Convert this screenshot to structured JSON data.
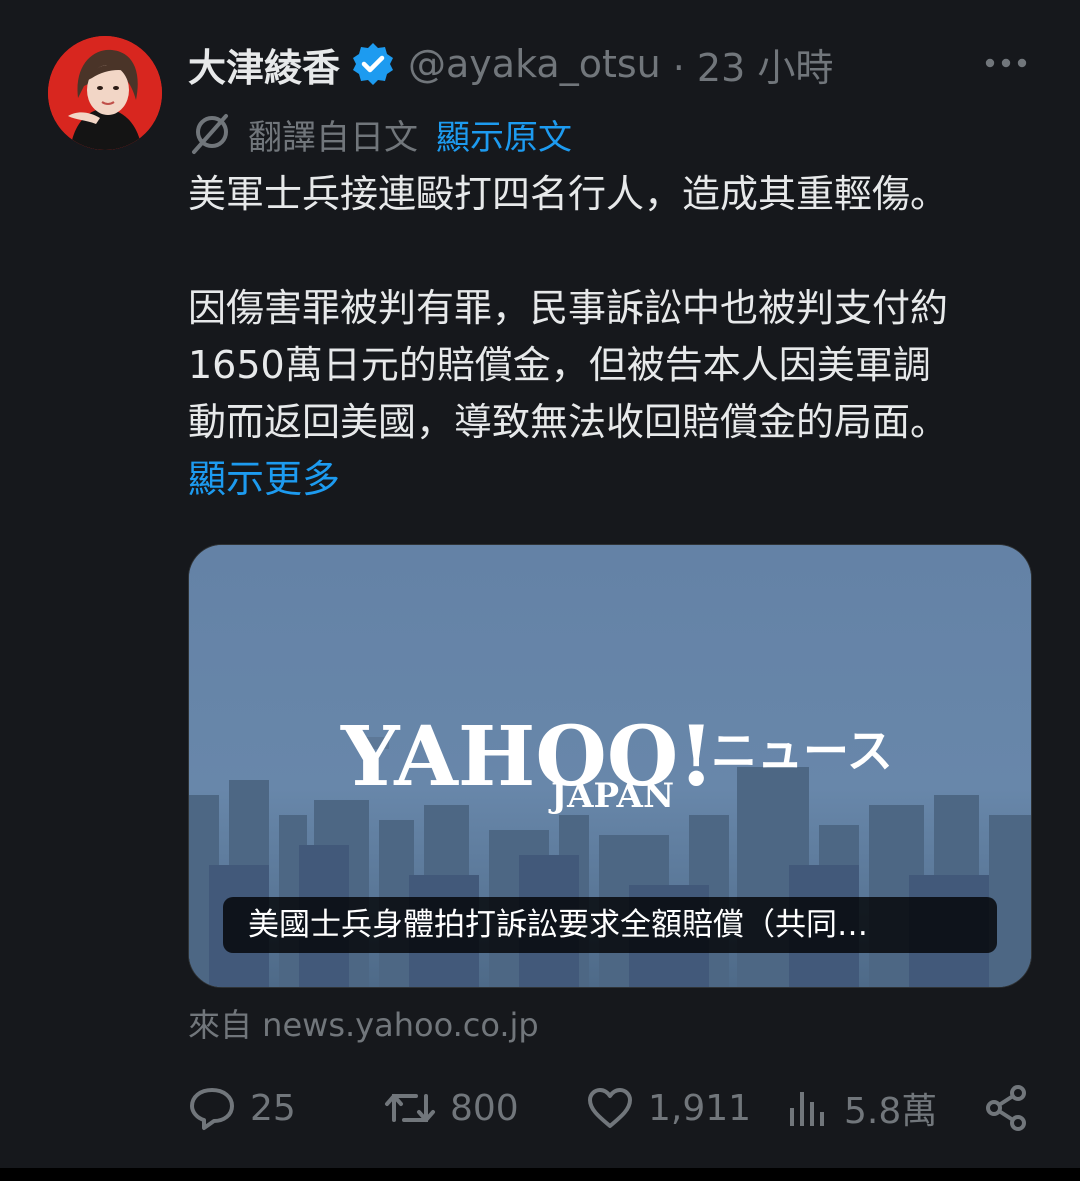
{
  "author": {
    "name": "大津綾香",
    "handle": "@ayaka_otsu",
    "time": "· 23 小時",
    "verified": true
  },
  "translation": {
    "label": "翻譯自日文",
    "show_original": "顯示原文"
  },
  "body": {
    "paragraph_1": "美軍士兵接連毆打四名行人，造成其重輕傷。",
    "paragraph_2_line_1": "因傷害罪被判有罪，民事訴訟中也被判支付約",
    "paragraph_2_line_2": "1650萬日元的賠償金，但被告本人因美軍調",
    "paragraph_2_line_3": "動而返回美國，導致無法收回賠償金的局面。",
    "show_more": "顯示更多"
  },
  "card": {
    "logo_text": "YAHOO!",
    "logo_sub": "JAPAN",
    "logo_news": "ニュース",
    "caption": "美國士兵身體拍打訴訟要求全額賠償（共同…",
    "source": "來自 news.yahoo.co.jp"
  },
  "actions": {
    "replies": "25",
    "reposts": "800",
    "likes": "1,911",
    "views": "5.8萬"
  },
  "colors": {
    "accent": "#1d9bf0",
    "muted": "#71767b",
    "background": "#16181c"
  }
}
